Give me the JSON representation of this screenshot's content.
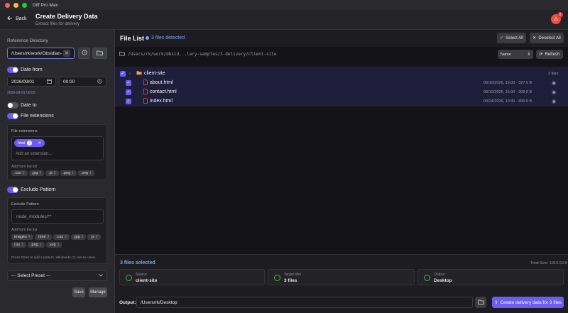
{
  "window": {
    "title": "Diff Pro Max"
  },
  "header": {
    "back_label": "Back",
    "title": "Create Delivery Data",
    "subtitle": "Extract files for delivery",
    "alert_count": "0"
  },
  "sidebar": {
    "reference_label": "Reference Directory",
    "reference_value": "/Users/rk/work/Obsidian-gitc",
    "date_from": {
      "label": "Date from",
      "enabled": true,
      "date": "2026/09/01",
      "time": "00:00",
      "hint": "2026-09-01 00:00"
    },
    "date_to": {
      "label": "Date to",
      "enabled": false
    },
    "file_ext": {
      "label": "File extensions",
      "enabled": true,
      "panel_label": "File extensions",
      "selected": [
        {
          "name": "html",
          "count": "3"
        }
      ],
      "input_placeholder": "Add an extension...",
      "add_label": "Add from the list",
      "options": [
        {
          "name": ".css",
          "count": "2"
        },
        {
          "name": ".jpg",
          "count": "2"
        },
        {
          "name": ".js",
          "count": "2"
        },
        {
          "name": ".png",
          "count": "1"
        },
        {
          "name": ".svg",
          "count": "1"
        }
      ]
    },
    "exclude": {
      "label": "Exclude Pattern",
      "enabled": true,
      "panel_label": "Exclude Pattern",
      "input_placeholder": "node_modules/**",
      "add_label": "Add from the list",
      "options": [
        {
          "name": "images",
          "count": "4"
        },
        {
          "name": ".html",
          "count": "3"
        },
        {
          "name": ".css",
          "count": "2"
        },
        {
          "name": ".jpg",
          "count": "2"
        },
        {
          "name": ".js",
          "count": "2"
        },
        {
          "name": "css",
          "count": "2"
        },
        {
          "name": ".png",
          "count": "1"
        },
        {
          "name": ".svg",
          "count": "1"
        }
      ],
      "help": "Press Enter to add a pattern. Wildcards (*) can be used."
    },
    "preset_placeholder": "--- Select Preset ---",
    "save_label": "Save",
    "manage_label": "Manage"
  },
  "filelist": {
    "title": "File List",
    "detected": "3 files detected",
    "select_all": "Select All",
    "deselect_all": "Deselect All",
    "path": "/Users/rk/work/Obsid...lery-samples/3-delivery/client-site",
    "sort_value": "Name",
    "refresh_label": "Refresh",
    "folder": {
      "name": "client-site",
      "count": "3 files"
    },
    "files": [
      {
        "name": "about.html",
        "meta": "09/10/2026, 15:00 · 327.0 B"
      },
      {
        "name": "contact.html",
        "meta": "09/10/2026, 15:00 · 309.0 B"
      },
      {
        "name": "index.html",
        "meta": "09/24/2026, 10:30 · 890.0 B"
      }
    ]
  },
  "footer": {
    "selected": "3 files selected",
    "total": "Total Size: 1916.00 B",
    "cards": [
      {
        "label": "Source",
        "value": "client-site"
      },
      {
        "label": "Target files",
        "value": "3 files"
      },
      {
        "label": "Output",
        "value": "Desktop"
      }
    ],
    "output_label": "Output:",
    "output_value": "/Users/rk/Desktop",
    "create_label": "Create delivery data for 3 files"
  }
}
